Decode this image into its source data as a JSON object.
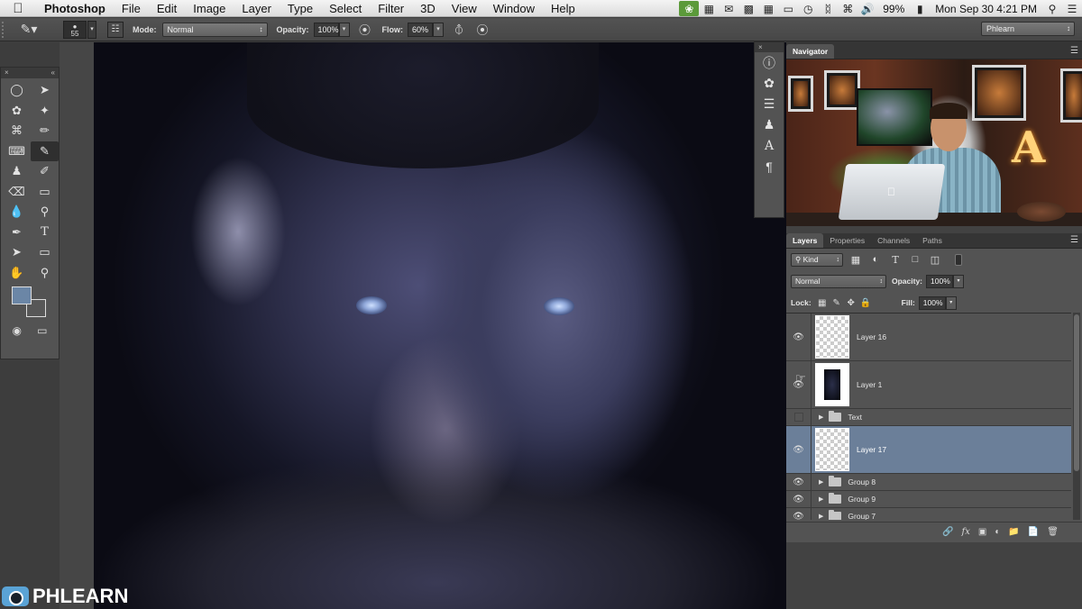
{
  "menubar": {
    "app_name": "Photoshop",
    "menus": [
      "File",
      "Edit",
      "Image",
      "Layer",
      "Type",
      "Select",
      "Filter",
      "3D",
      "View",
      "Window",
      "Help"
    ],
    "battery": "99%",
    "datetime": "Mon Sep 30  4:21 PM"
  },
  "options_bar": {
    "brush_size": "55",
    "mode_label": "Mode:",
    "mode_value": "Normal",
    "opacity_label": "Opacity:",
    "opacity_value": "100%",
    "flow_label": "Flow:",
    "flow_value": "60%",
    "workspace": "Phlearn"
  },
  "colors": {
    "foreground": "#6b86a6",
    "background": "#575757",
    "selected_layer": "#6b7f99"
  },
  "navigator": {
    "tab": "Navigator"
  },
  "layers_panel": {
    "tabs": [
      "Layers",
      "Properties",
      "Channels",
      "Paths"
    ],
    "filter_kind": "Kind",
    "blend_mode": "Normal",
    "opacity_label": "Opacity:",
    "opacity_value": "100%",
    "lock_label": "Lock:",
    "fill_label": "Fill:",
    "fill_value": "100%",
    "layers": [
      {
        "name": "Layer 16",
        "type": "layer",
        "visible": true,
        "selected": false
      },
      {
        "name": "Layer 1",
        "type": "layer",
        "visible": true,
        "selected": false
      },
      {
        "name": "Text",
        "type": "group",
        "visible": false,
        "selected": false
      },
      {
        "name": "Layer 17",
        "type": "layer",
        "visible": true,
        "selected": true
      },
      {
        "name": "Group 8",
        "type": "group",
        "visible": true,
        "selected": false
      },
      {
        "name": "Group 9",
        "type": "group",
        "visible": true,
        "selected": false
      },
      {
        "name": "Group 7",
        "type": "group",
        "visible": true,
        "selected": false
      }
    ]
  },
  "watermark": {
    "text": "PHLEARN"
  }
}
